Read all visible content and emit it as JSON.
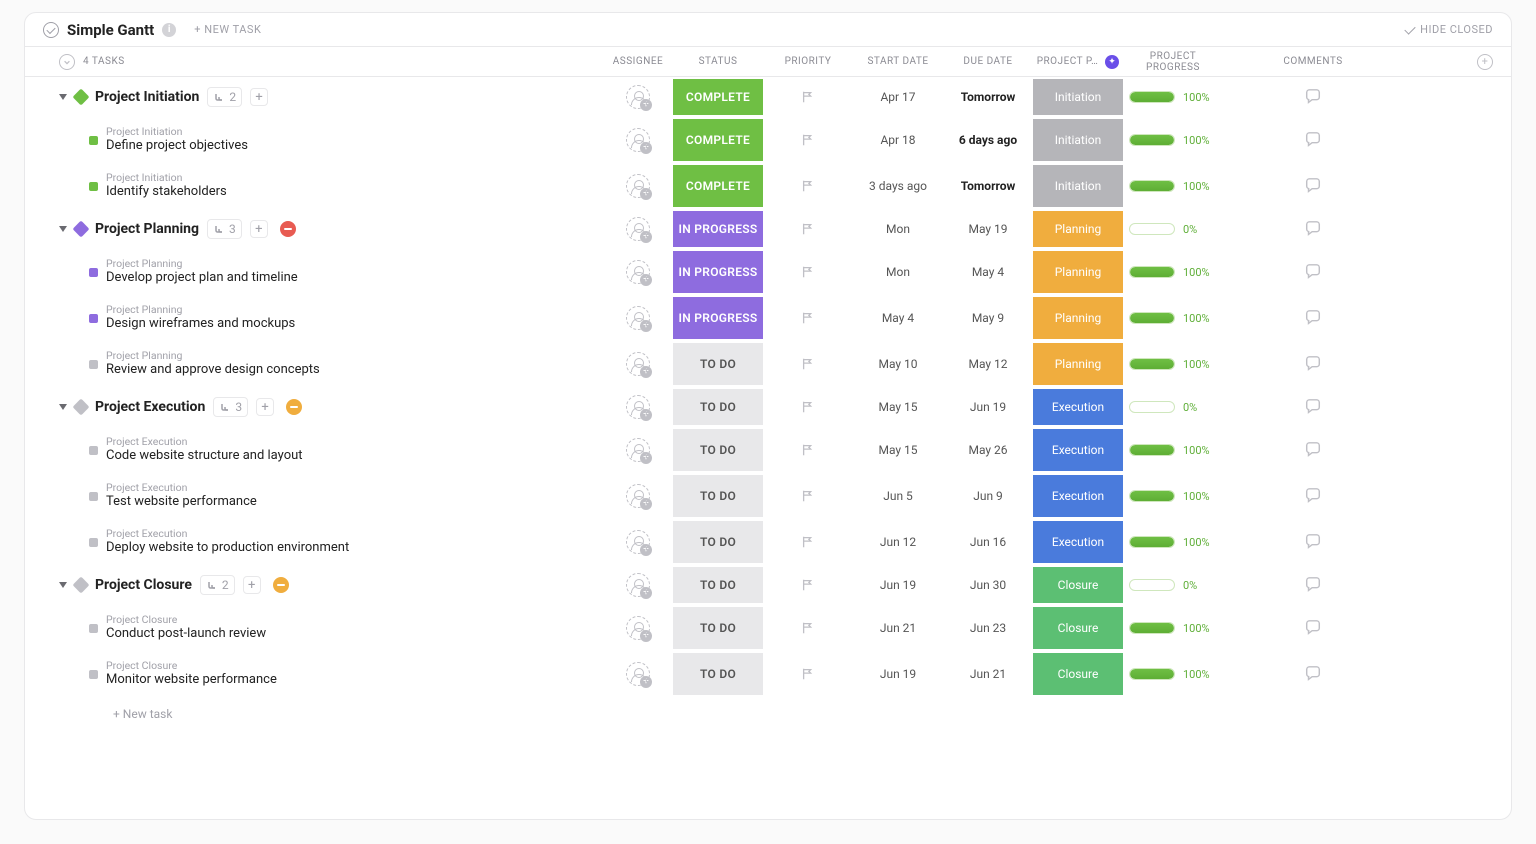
{
  "header": {
    "title": "Simple Gantt",
    "new_task": "+ NEW TASK",
    "hide_closed": "HIDE CLOSED"
  },
  "columns": {
    "tasks_count": "4 TASKS",
    "assignee": "ASSIGNEE",
    "status": "STATUS",
    "priority": "PRIORITY",
    "start": "START DATE",
    "due": "DUE DATE",
    "phase": "PROJECT P…",
    "progress": "PROJECT PROGRESS",
    "comments": "COMMENTS",
    "add_col": "+"
  },
  "status_labels": {
    "complete": "COMPLETE",
    "in_progress": "IN PROGRESS",
    "todo": "TO DO"
  },
  "phase_labels": {
    "initiation": "Initiation",
    "planning": "Planning",
    "execution": "Execution",
    "closure": "Closure"
  },
  "groups": [
    {
      "name": "Project Initiation",
      "color": "#6fbf44",
      "sub_count": "2",
      "extra_dot": null,
      "status": "complete",
      "start": "Apr 17",
      "due": "Tomorrow",
      "due_bold": true,
      "phase": "initiation",
      "progress_pct": 100,
      "progress_text": "100%",
      "subtasks": [
        {
          "parent": "Project Initiation",
          "title": "Define project objectives",
          "sq_color": "#6fbf44",
          "status": "complete",
          "start": "Apr 18",
          "due": "6 days ago",
          "due_bold": true,
          "phase": "initiation",
          "progress_pct": 100,
          "progress_text": "100%"
        },
        {
          "parent": "Project Initiation",
          "title": "Identify stakeholders",
          "sq_color": "#6fbf44",
          "status": "complete",
          "start": "3 days ago",
          "due": "Tomorrow",
          "due_bold": true,
          "phase": "initiation",
          "progress_pct": 100,
          "progress_text": "100%"
        }
      ]
    },
    {
      "name": "Project Planning",
      "color": "#8e6cdf",
      "sub_count": "3",
      "extra_dot": "red",
      "status": "in_progress",
      "start": "Mon",
      "due": "May 19",
      "due_bold": false,
      "phase": "planning",
      "progress_pct": 0,
      "progress_text": "0%",
      "subtasks": [
        {
          "parent": "Project Planning",
          "title": "Develop project plan and timeline",
          "sq_color": "#8e6cdf",
          "status": "in_progress",
          "start": "Mon",
          "due": "May 4",
          "due_bold": false,
          "phase": "planning",
          "progress_pct": 100,
          "progress_text": "100%"
        },
        {
          "parent": "Project Planning",
          "title": "Design wireframes and mockups",
          "sq_color": "#8e6cdf",
          "status": "in_progress",
          "start": "May 4",
          "due": "May 9",
          "due_bold": false,
          "phase": "planning",
          "progress_pct": 100,
          "progress_text": "100%"
        },
        {
          "parent": "Project Planning",
          "title": "Review and approve design concepts",
          "sq_color": "#c0c0c6",
          "status": "todo",
          "start": "May 10",
          "due": "May 12",
          "due_bold": false,
          "phase": "planning",
          "progress_pct": 100,
          "progress_text": "100%"
        }
      ]
    },
    {
      "name": "Project Execution",
      "color": "#c0c0c6",
      "sub_count": "3",
      "extra_dot": "yellow",
      "status": "todo",
      "start": "May 15",
      "due": "Jun 19",
      "due_bold": false,
      "phase": "execution",
      "progress_pct": 0,
      "progress_text": "0%",
      "subtasks": [
        {
          "parent": "Project Execution",
          "title": "Code website structure and layout",
          "sq_color": "#c0c0c6",
          "status": "todo",
          "start": "May 15",
          "due": "May 26",
          "due_bold": false,
          "phase": "execution",
          "progress_pct": 100,
          "progress_text": "100%"
        },
        {
          "parent": "Project Execution",
          "title": "Test website performance",
          "sq_color": "#c0c0c6",
          "status": "todo",
          "start": "Jun 5",
          "due": "Jun 9",
          "due_bold": false,
          "phase": "execution",
          "progress_pct": 100,
          "progress_text": "100%"
        },
        {
          "parent": "Project Execution",
          "title": "Deploy website to production environment",
          "sq_color": "#c0c0c6",
          "status": "todo",
          "start": "Jun 12",
          "due": "Jun 16",
          "due_bold": false,
          "phase": "execution",
          "progress_pct": 100,
          "progress_text": "100%"
        }
      ]
    },
    {
      "name": "Project Closure",
      "color": "#c0c0c6",
      "sub_count": "2",
      "extra_dot": "yellow",
      "status": "todo",
      "start": "Jun 19",
      "due": "Jun 30",
      "due_bold": false,
      "phase": "closure",
      "progress_pct": 0,
      "progress_text": "0%",
      "subtasks": [
        {
          "parent": "Project Closure",
          "title": "Conduct post-launch review",
          "sq_color": "#c0c0c6",
          "status": "todo",
          "start": "Jun 21",
          "due": "Jun 23",
          "due_bold": false,
          "phase": "closure",
          "progress_pct": 100,
          "progress_text": "100%"
        },
        {
          "parent": "Project Closure",
          "title": "Monitor website performance",
          "sq_color": "#c0c0c6",
          "status": "todo",
          "start": "Jun 19",
          "due": "Jun 21",
          "due_bold": false,
          "phase": "closure",
          "progress_pct": 100,
          "progress_text": "100%"
        }
      ]
    }
  ],
  "new_task_row": "+ New task"
}
